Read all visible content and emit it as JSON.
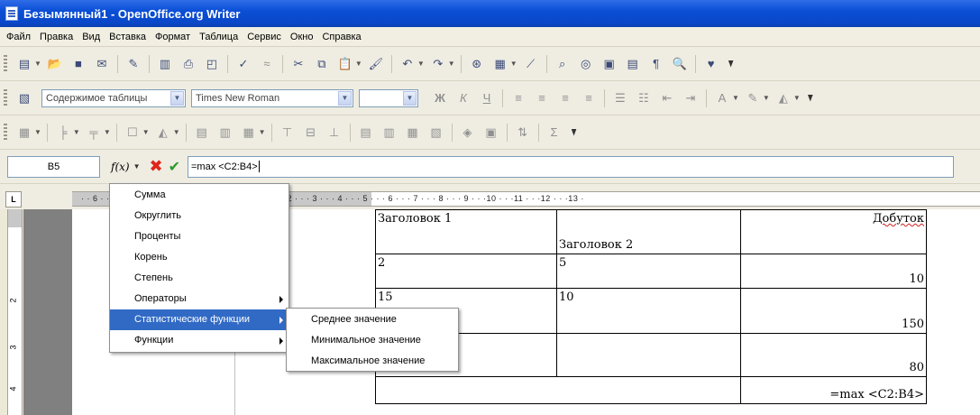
{
  "window": {
    "title": "Безымянный1 - OpenOffice.org Writer"
  },
  "menubar": [
    "Файл",
    "Правка",
    "Вид",
    "Вставка",
    "Формат",
    "Таблица",
    "Сервис",
    "Окно",
    "Справка"
  ],
  "format_toolbar": {
    "style_value": "Содержимое таблицы",
    "font_value": "Times New Roman",
    "size_value": ""
  },
  "formula_bar": {
    "cell_ref": "B5",
    "fx_label": "f(x)",
    "formula": "=max <C2:B4>"
  },
  "ruler": {
    "text": "· · 6 · · · 5 · · · 4 · · · 3 · · · 2 · · · 1 · · ·   · · · 1 · · · 2 · · · 3 · · · 4 · · · 5 · · · 6 · · · 7 · · · 8 · · · 9 · · ·10 · · ·11 · · ·12 · · ·13 ·",
    "v_marks": [
      "2",
      "3",
      "4"
    ]
  },
  "formula_menu": {
    "items": [
      "Сумма",
      "Округлить",
      "Проценты",
      "Корень",
      "Степень",
      "Операторы",
      "Статистические функции",
      "Функции"
    ],
    "highlighted": "Статистические функции"
  },
  "statistical_submenu": {
    "items": [
      "Среднее значение",
      "Минимальное значение",
      "Максимальное значение"
    ]
  },
  "table": {
    "rows": [
      [
        "Заголовок 1",
        "Заголовок 2",
        "Добуток"
      ],
      [
        "2",
        "5",
        "10"
      ],
      [
        "15",
        "10",
        "150"
      ],
      [
        "",
        "",
        "80"
      ],
      [
        "",
        "",
        "=max <C2:B4>"
      ]
    ]
  }
}
